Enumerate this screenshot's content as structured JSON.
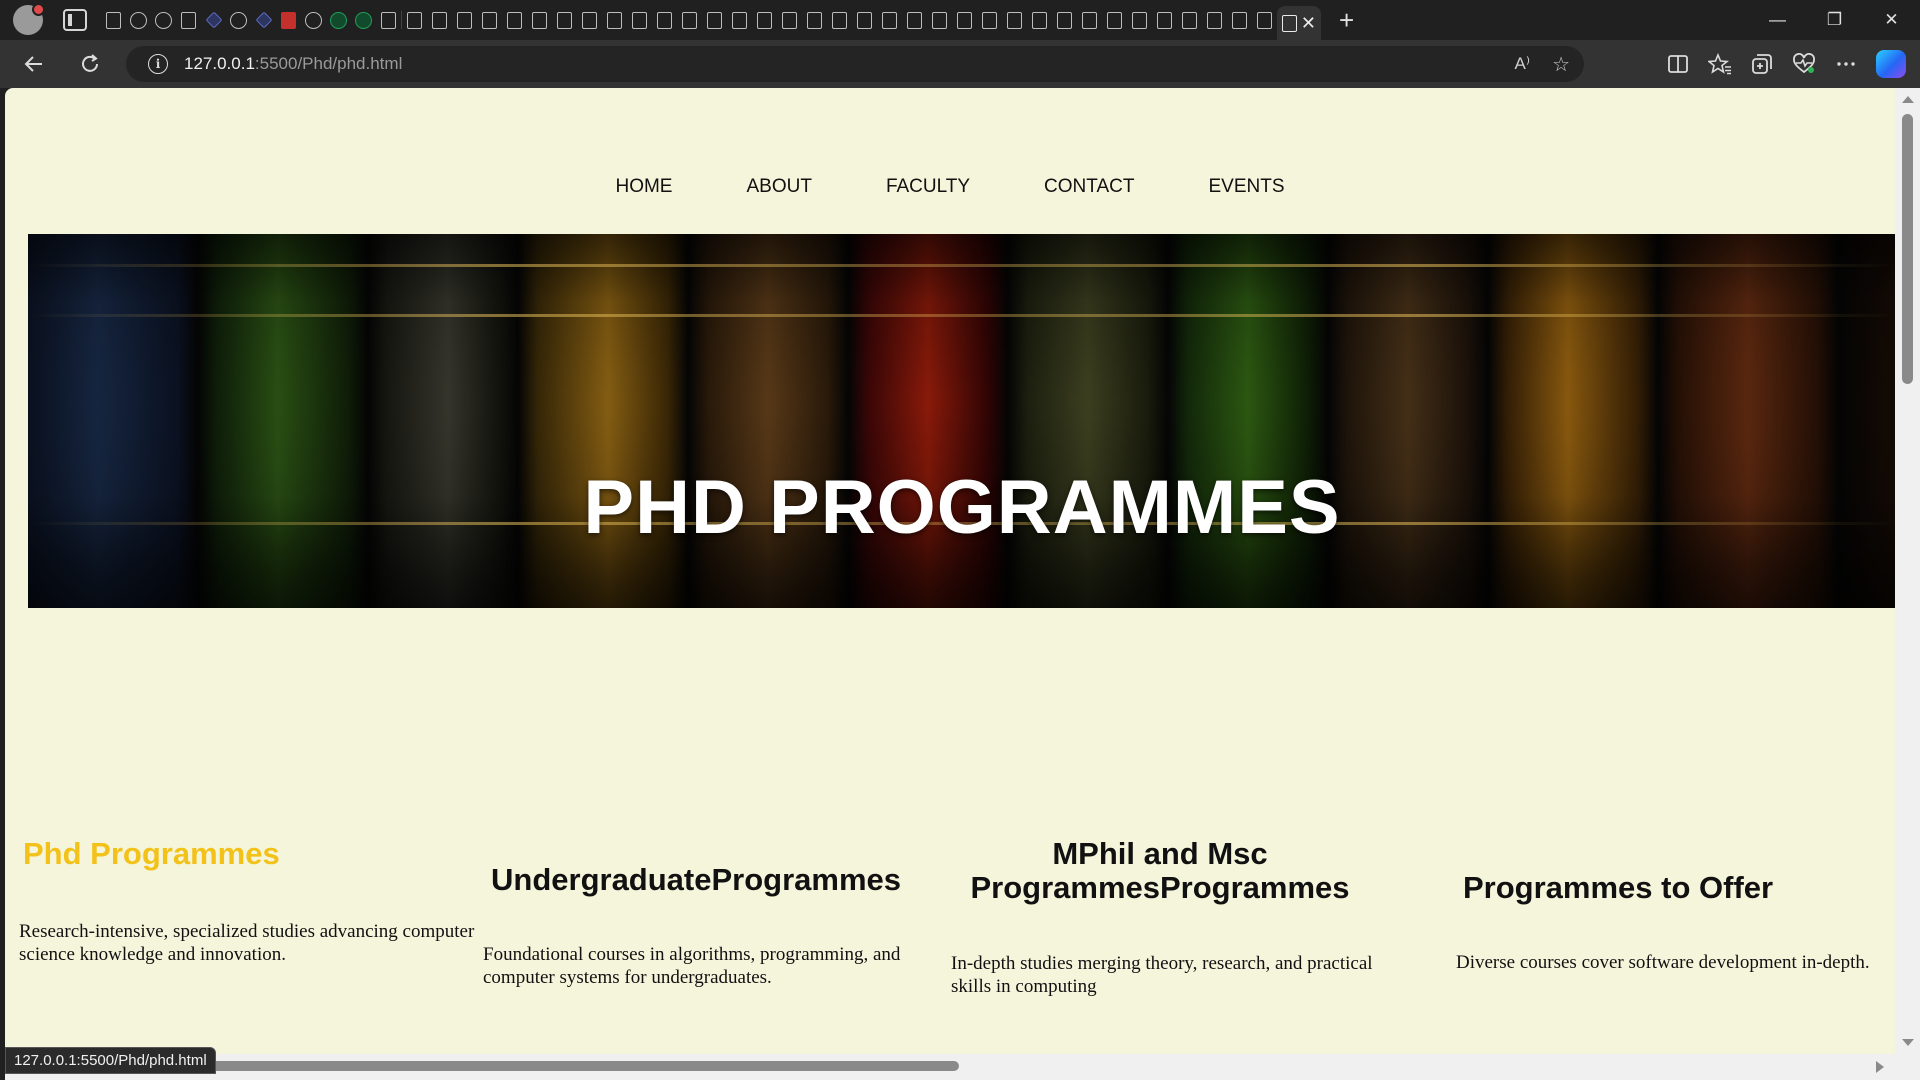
{
  "browser": {
    "url_host": "127.0.0.1",
    "url_path": ":5500/Phd/phd.html",
    "status_url": "127.0.0.1:5500/Phd/phd.html",
    "icons": {
      "back": "back-arrow-icon",
      "refresh": "refresh-icon",
      "info": "info-icon",
      "read_aloud": "read-aloud-icon",
      "favorite": "star-icon",
      "split": "split-screen-icon",
      "favorites": "favorites-icon",
      "collections": "collections-icon",
      "health": "browser-essentials-icon",
      "more": "more-icon",
      "copilot": "copilot-icon"
    },
    "info_glyph": "i",
    "read_aloud_glyph": "A⁾",
    "window": {
      "minimize": "—",
      "restore": "❐",
      "close": "✕"
    },
    "new_tab": "+",
    "tab_close": "✕"
  },
  "page": {
    "nav": [
      "HOME",
      "ABOUT",
      "FACULTY",
      "CONTACT",
      "EVENTS"
    ],
    "hero_title": "PHD PROGRAMMES",
    "sections": [
      {
        "heading": "Phd Programmes",
        "text": "Research-intensive, specialized studies advancing computer science knowledge and innovation."
      },
      {
        "heading": "UndergraduateProgrammes",
        "text": "Foundational courses in algorithms, programming, and computer systems for undergraduates."
      },
      {
        "heading": "MPhil and Msc ProgrammesProgrammes",
        "text": "In-depth studies merging theory, research, and practical skills in computing"
      },
      {
        "heading": "Programmes to Offer",
        "text": "Diverse courses cover software development in-depth."
      }
    ]
  },
  "colors": {
    "page_bg": "#f5f5dc",
    "accent_heading": "#f3c21a",
    "chrome_bg": "#202020",
    "toolbar_bg": "#333333"
  }
}
